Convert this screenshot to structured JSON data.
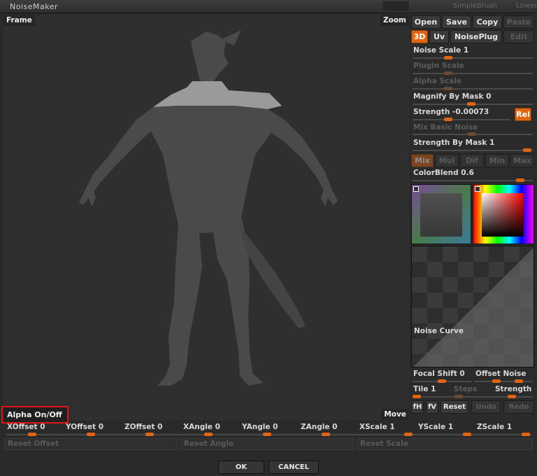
{
  "window": {
    "title": "NoiseMaker",
    "logo": "zbrush-logo",
    "right1": "SimpleBrush",
    "right2": "Lower"
  },
  "viewport": {
    "frame_label": "Frame",
    "zoom_label": "Zoom",
    "move_label": "Move",
    "alpha_label": "Alpha On/Off",
    "subject": "3d-creature-model"
  },
  "panel": {
    "open": "Open",
    "save": "Save",
    "copy": "Copy",
    "paste": "Paste",
    "tab_3d": "3D",
    "tab_uv": "Uv",
    "tab_noiseplug": "NoisePlug",
    "tab_edit": "Edit",
    "noise_scale": "Noise Scale 1",
    "plugin_scale": "Plugin Scale",
    "alpha_scale": "Alpha Scale",
    "magnify_by_mask": "Magnify By Mask 0",
    "strength": "Strength -0.00073",
    "rel": "Rel",
    "mix_basic_noise": "Mix Basic Noise",
    "strength_by_mask": "Strength By Mask 1",
    "blend_modes": [
      "Mix",
      "Mul",
      "Dif",
      "Min",
      "Max"
    ],
    "color_blend": "ColorBlend 0.6",
    "noise_curve": "Noise Curve",
    "focal_shift": "Focal Shift 0",
    "offset_noise": "Offset Noise",
    "tile": "Tile 1",
    "steps": "Steps",
    "strength2": "Strength",
    "fh": "fH",
    "fv": "fV",
    "reset": "Reset",
    "undo": "Undo",
    "redo": "Redo"
  },
  "bottom": {
    "sliders": [
      "XOffset 0",
      "YOffset 0",
      "ZOffset 0",
      "XAngle 0",
      "YAngle 0",
      "ZAngle 0",
      "XScale 1",
      "YScale 1",
      "ZScale 1"
    ],
    "reset_offset": "Reset Offset",
    "reset_angle": "Reset Angle",
    "reset_scale": "Reset Scale"
  },
  "dialog": {
    "ok": "OK",
    "cancel": "CANCEL"
  },
  "colors": {
    "accent": "#e06412",
    "highlight_box": "#e01515"
  }
}
